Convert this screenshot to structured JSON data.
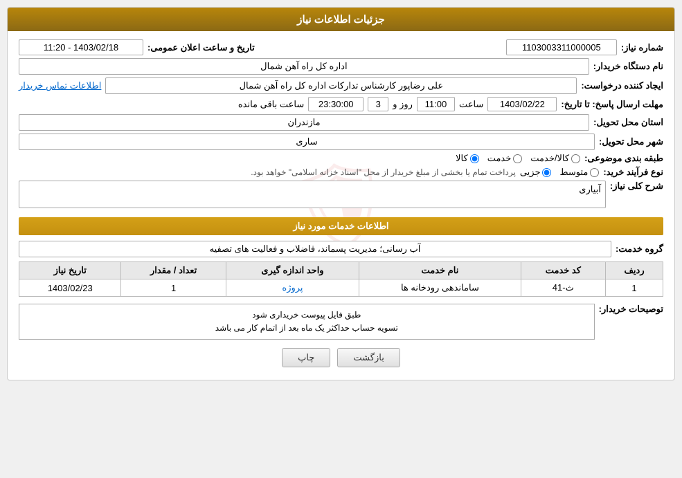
{
  "header": {
    "title": "جزئیات اطلاعات نیاز"
  },
  "info_section": {
    "need_number_label": "شماره نیاز:",
    "need_number_value": "1103003311000005",
    "org_name_label": "نام دستگاه خریدار:",
    "org_name_value": "اداره کل راه آهن شمال",
    "announcement_label": "تاریخ و ساعت اعلان عمومی:",
    "announcement_value": "1403/02/18 - 11:20",
    "creator_label": "ایجاد کننده درخواست:",
    "creator_value": "علی رضاپور کارشناس تدارکات اداره کل راه آهن شمال",
    "contact_link": "اطلاعات تماس خریدار",
    "deadline_label": "مهلت ارسال پاسخ: تا تاریخ:",
    "deadline_date": "1403/02/22",
    "deadline_time_label": "ساعت",
    "deadline_time": "11:00",
    "deadline_days_label": "روز و",
    "deadline_days": "3",
    "deadline_remaining_label": "ساعت باقی مانده",
    "deadline_remaining": "23:30:00",
    "province_label": "استان محل تحویل:",
    "province_value": "مازندران",
    "city_label": "شهر محل تحویل:",
    "city_value": "ساری",
    "category_label": "طبقه بندی موضوعی:",
    "category_options": [
      {
        "label": "کالا",
        "value": "kala"
      },
      {
        "label": "خدمت",
        "value": "khedmat"
      },
      {
        "label": "کالا/خدمت",
        "value": "both"
      }
    ],
    "category_selected": "kala",
    "purchase_type_label": "نوع فرآیند خرید:",
    "purchase_type_options": [
      {
        "label": "جزیی",
        "value": "jozei"
      },
      {
        "label": "متوسط",
        "value": "motavset"
      }
    ],
    "purchase_type_selected": "jozei",
    "purchase_type_note": "پرداخت تمام یا بخشی از مبلغ خریدار از محل \"اسناد خزانه اسلامی\" خواهد بود."
  },
  "need_description": {
    "title": "شرح کلی نیاز:",
    "value": "آبیاری"
  },
  "services_section": {
    "title": "اطلاعات خدمات مورد نیاز",
    "group_label": "گروه خدمت:",
    "group_value": "آب رسانی؛ مدیریت پسماند، فاضلاب و فعالیت های تصفیه",
    "table": {
      "headers": [
        "ردیف",
        "کد خدمت",
        "نام خدمت",
        "واحد اندازه گیری",
        "تعداد / مقدار",
        "تاریخ نیاز"
      ],
      "rows": [
        {
          "row": "1",
          "code": "ث-41",
          "name": "ساماندهی رودخانه ها",
          "unit": "پروژه",
          "quantity": "1",
          "date": "1403/02/23"
        }
      ]
    }
  },
  "buyer_notes": {
    "title": "توصیحات خریدار:",
    "line1": "طبق فایل پیوست خریداری شود",
    "line2": "تسویه حساب حداکثر یک ماه بعد از اتمام کار می باشد"
  },
  "buttons": {
    "print": "چاپ",
    "back": "بازگشت"
  }
}
